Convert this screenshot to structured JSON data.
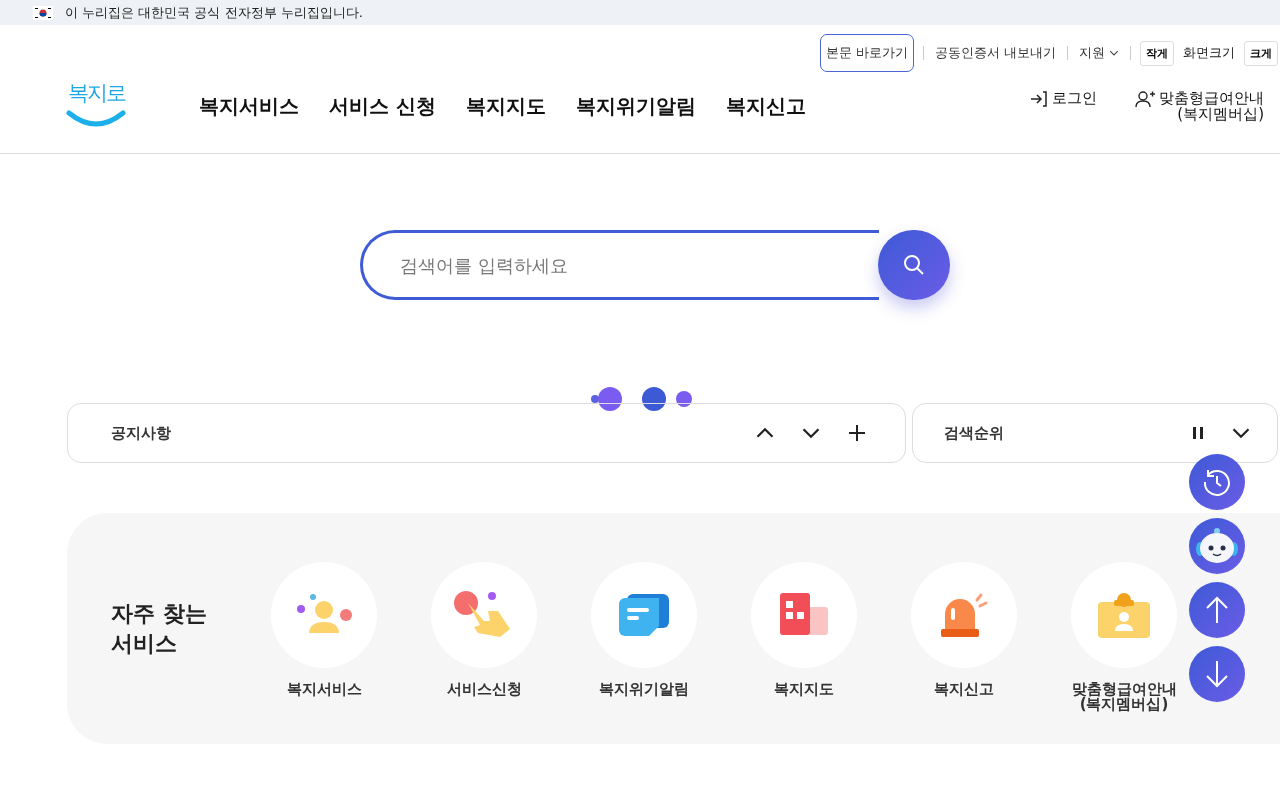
{
  "gov_banner": {
    "text": "이 누리집은 대한민국 공식 전자정부 누리집입니다."
  },
  "utility_links": [
    {
      "label": "본문 바로가기",
      "kind": "outlined"
    },
    {
      "label": "공동인증서 내보내기",
      "kind": "link"
    },
    {
      "label": "지원",
      "kind": "dropdown"
    }
  ],
  "font_size": {
    "smaller": "작게",
    "label": "화면크기",
    "larger": "크게"
  },
  "logo": {
    "text": "복지로"
  },
  "nav": [
    "복지서비스",
    "서비스 신청",
    "복지지도",
    "복지위기알림",
    "복지신고"
  ],
  "account": [
    {
      "label": "로그인",
      "kind": "login"
    },
    {
      "label": "맞춤형급여안내\n(복지멤버십)",
      "kind": "membership"
    }
  ],
  "search": {
    "placeholder": "검색어를 입력하세요"
  },
  "notice": {
    "title": "공지사항"
  },
  "ranking": {
    "title": "검색순위"
  },
  "frequent": {
    "title": "자주 찾는\n서비스",
    "items": [
      {
        "label": "복지서비스",
        "kind": "person"
      },
      {
        "label": "서비스신청",
        "kind": "hand"
      },
      {
        "label": "복지위기알림",
        "kind": "message"
      },
      {
        "label": "복지지도",
        "kind": "building"
      },
      {
        "label": "복지신고",
        "kind": "siren"
      },
      {
        "label": "맞춤형급여안내\n(복지멤버십)",
        "kind": "card"
      }
    ]
  },
  "floating": [
    {
      "kind": "history"
    },
    {
      "kind": "chatbot"
    },
    {
      "kind": "top"
    },
    {
      "kind": "bottom"
    }
  ]
}
